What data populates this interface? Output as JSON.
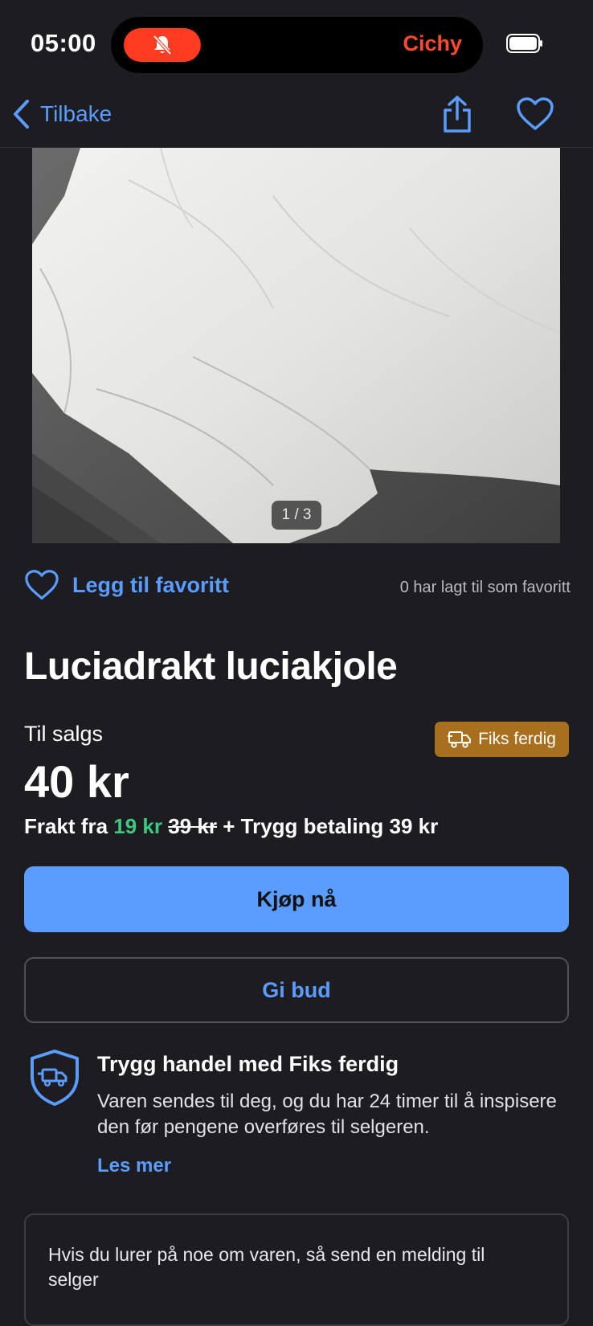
{
  "status_bar": {
    "time": "05:00",
    "island_label": "Cichy",
    "silent_icon": "bell-slash-icon",
    "battery_icon": "battery-icon"
  },
  "nav": {
    "back_label": "Tilbake",
    "share_icon": "share-icon",
    "favorite_icon": "heart-icon"
  },
  "gallery": {
    "counter": "1 / 3"
  },
  "favorite": {
    "add_label": "Legg til favoritt",
    "count_text": "0 har lagt til som favoritt"
  },
  "listing": {
    "title": "Luciadrakt luciakjole",
    "status": "Til salgs",
    "badge": "Fiks ferdig",
    "price": "40 kr",
    "shipping_prefix": "Frakt fra",
    "shipping_price": "19 kr",
    "shipping_old_price": "39 kr",
    "shipping_suffix": "+ Trygg betaling 39 kr"
  },
  "actions": {
    "buy_label": "Kjøp nå",
    "bid_label": "Gi bud"
  },
  "trust": {
    "title": "Trygg handel med Fiks ferdig",
    "body": "Varen sendes til deg, og du har 24 timer til å inspisere den før pengene overføres til selgeren.",
    "link": "Les mer"
  },
  "message": {
    "text": "Hvis du lurer på noe om varen, så send en melding til selger"
  },
  "colors": {
    "accent": "#5a9cff",
    "background": "#1c1c21",
    "badge": "#a86f1f",
    "green": "#3ec983",
    "alert": "#ff3b22"
  }
}
